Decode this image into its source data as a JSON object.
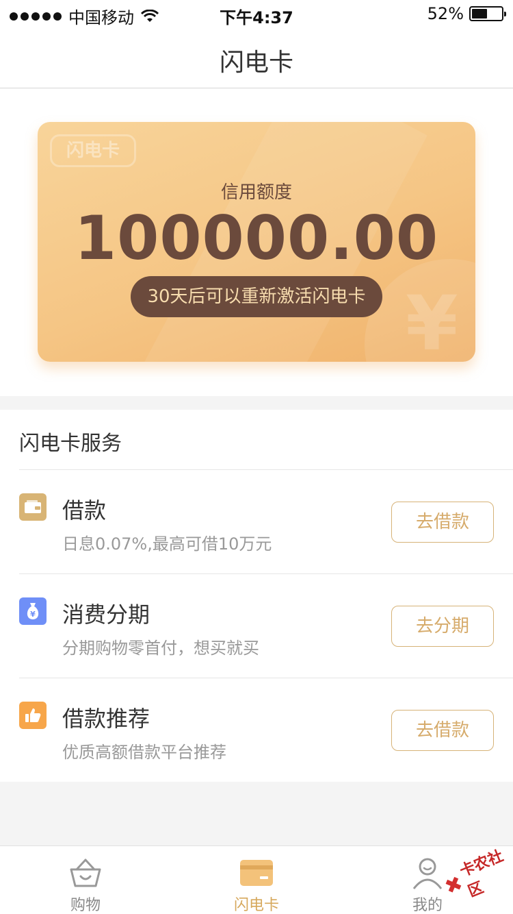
{
  "status_bar": {
    "carrier": "中国移动",
    "time": "下午4:37",
    "battery_percent": "52%",
    "battery_level": 0.52
  },
  "nav": {
    "title": "闪电卡"
  },
  "card": {
    "watermark": "闪电卡",
    "label": "信用额度",
    "amount": "100000.00",
    "notice": "30天后可以重新激活闪电卡",
    "deco_symbol": "¥"
  },
  "services": {
    "title": "闪电卡服务",
    "items": [
      {
        "title": "借款",
        "subtitle": "日息0.07%,最高可借10万元",
        "button": "去借款",
        "icon": "wallet-icon",
        "icon_color": "#d8b475"
      },
      {
        "title": "消费分期",
        "subtitle": "分期购物零首付，想买就买",
        "button": "去分期",
        "icon": "money-bag-icon",
        "icon_color": "#6f8ff7"
      },
      {
        "title": "借款推荐",
        "subtitle": "优质高额借款平台推荐",
        "button": "去借款",
        "icon": "thumbs-up-icon",
        "icon_color": "#f7a64a"
      }
    ]
  },
  "tabs": [
    {
      "label": "购物",
      "icon": "basket-icon",
      "active": false
    },
    {
      "label": "闪电卡",
      "icon": "card-icon",
      "active": true
    },
    {
      "label": "我的",
      "icon": "user-icon",
      "active": false
    }
  ],
  "watermark_logo": {
    "text": "卡农社区"
  },
  "colors": {
    "accent": "#d6a85c",
    "card_text": "#6b4a3c",
    "pill_text": "#f7dcae",
    "button_border": "#d6b277"
  }
}
